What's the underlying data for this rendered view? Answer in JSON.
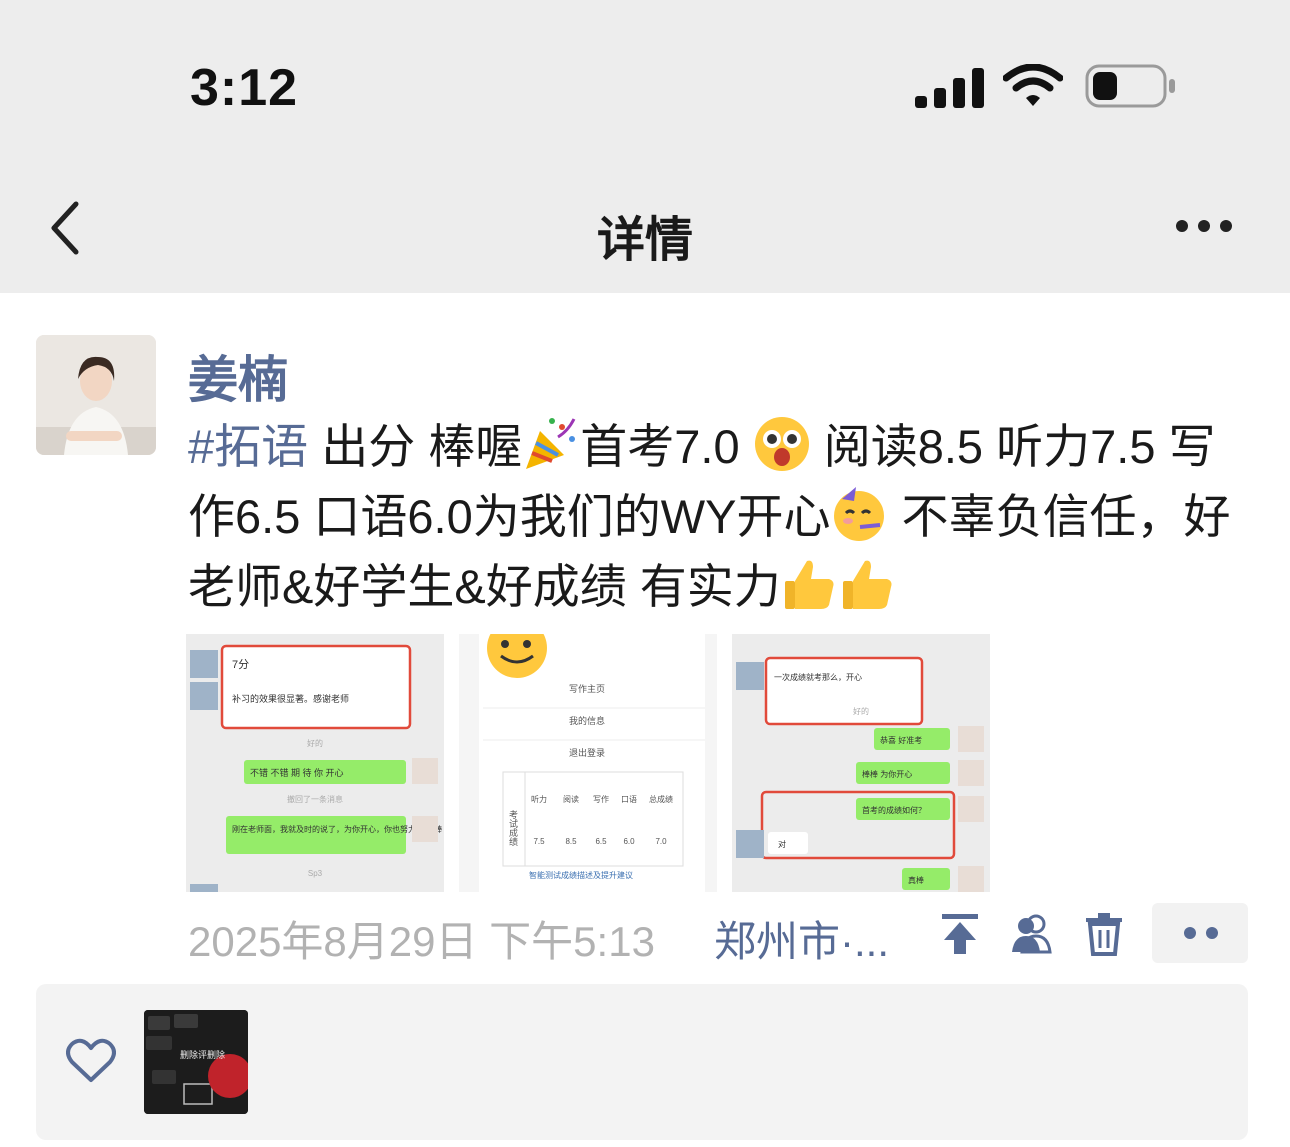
{
  "status": {
    "time": "3:12"
  },
  "nav": {
    "title": "详情",
    "back_icon": "chevron-left-icon",
    "more_icon": "more-dots-icon"
  },
  "post": {
    "author": "姜楠",
    "hashtag": "#拓语",
    "text_1": " 出分 棒喔",
    "text_2": "首考7.0 ",
    "text_3": " 阅读8.5 听力7.5 写作6.5 口语6.0为我们的WY开心",
    "text_4": " 不辜负信任，好老师&好学生&好成绩 有实力",
    "time": "2025年8月29日 下午5:13",
    "location": "郑州市·...",
    "images": [
      {
        "bubble_top": "7分",
        "bubble_1": "补习的效果很显著。感谢老师",
        "center_1": "好的",
        "green_1": "不错 不错 期 待 你 开心",
        "center_2": "撤回了一条消息",
        "green_2": "刚在老师面，我就及时的说了，为你开心，你也努力了 棒棒",
        "center_3": "Sp3"
      },
      {
        "menu_1": "写作主页",
        "menu_2": "我的信息",
        "menu_3": "退出登录",
        "side_label": "考试成绩",
        "col_1": "听力",
        "col_2": "阅读",
        "col_3": "写作",
        "col_4": "口语",
        "col_5": "总成绩",
        "val_1": "7.5",
        "val_2": "8.5",
        "val_3": "6.5",
        "val_4": "6.0",
        "val_5": "7.0",
        "note": "智能测试成绩描述及提升建议"
      },
      {
        "bubble_1": "一次成绩就考那么，开心",
        "center_1": "好的",
        "green_1": "恭喜 好准考",
        "green_2": "棒棒 为你开心",
        "green_3": "首考的成绩如何？",
        "white_1": "对",
        "green_4": "真棒"
      }
    ]
  },
  "actions": {
    "pin_icon": "pin-top-icon",
    "contacts_icon": "contacts-icon",
    "delete_icon": "trash-icon",
    "more_icon": "more-dots-icon"
  },
  "likes": {
    "heart_icon": "heart-outline-icon",
    "liker_caption": "删除评删除"
  },
  "colors": {
    "link": "#576b95",
    "bar": "#ededed",
    "muted": "#b2b2b2",
    "wechat_green": "#95ec69"
  }
}
